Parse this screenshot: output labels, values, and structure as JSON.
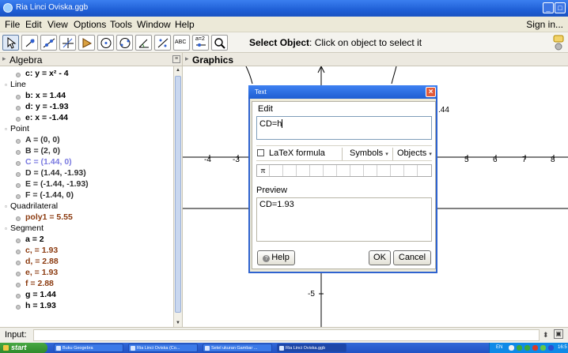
{
  "window": {
    "title": "Ria Linci Oviska.ggb"
  },
  "menu": {
    "items": [
      "File",
      "Edit",
      "View",
      "Options",
      "Tools",
      "Window",
      "Help"
    ],
    "signin": "Sign in..."
  },
  "toolbar": {
    "status_bold": "Select Object",
    "status_rest": ": Click on object to select it",
    "tools": [
      "move-tool",
      "point-tool",
      "line-tool",
      "perpendicular-line-tool",
      "polygon-tool",
      "circle-tool",
      "conic-tool",
      "angle-tool",
      "reflect-tool",
      "text-tool",
      "slider-tool",
      "zoom-tool"
    ],
    "text_tool_label": "ABC",
    "slider_tool_label": "a=2"
  },
  "algebra": {
    "header": "Algebra",
    "groups": [
      {
        "rows": [
          {
            "text": "c: y = x² - 4",
            "color": "#000000"
          }
        ]
      },
      {
        "category": "Line",
        "rows": [
          {
            "text": "b: x = 1.44",
            "color": "#000000"
          },
          {
            "text": "d: y = -1.93",
            "color": "#000000"
          },
          {
            "text": "e: x = -1.44",
            "color": "#000000"
          }
        ]
      },
      {
        "category": "Point",
        "rows": [
          {
            "text": "A = (0, 0)",
            "color": "#303030"
          },
          {
            "text": "B = (2, 0)",
            "color": "#303030"
          },
          {
            "text": "C = (1.44, 0)",
            "color": "#7a7ae0"
          },
          {
            "text": "D = (1.44, -1.93)",
            "color": "#303030"
          },
          {
            "text": "E = (-1.44, -1.93)",
            "color": "#303030"
          },
          {
            "text": "F = (-1.44, 0)",
            "color": "#303030"
          }
        ]
      },
      {
        "category": "Quadrilateral",
        "rows": [
          {
            "text": "poly1 = 5.55",
            "color": "#8b3a0f"
          }
        ]
      },
      {
        "category": "Segment",
        "rows": [
          {
            "text": "a = 2",
            "color": "#000000"
          },
          {
            "text": "c, = 1.93",
            "color": "#8b3a0f"
          },
          {
            "text": "d, = 2.88",
            "color": "#8b3a0f"
          },
          {
            "text": "e, = 1.93",
            "color": "#8b3a0f"
          },
          {
            "text": "f = 2.88",
            "color": "#8b3a0f"
          },
          {
            "text": "g = 1.44",
            "color": "#000000"
          },
          {
            "text": "h = 1.93",
            "color": "#000000"
          }
        ]
      }
    ]
  },
  "graphics": {
    "header": "Graphics",
    "x_ticks": [
      "-4",
      "-3",
      "5",
      "6",
      "7",
      "8"
    ],
    "y_ticks": [
      "-5"
    ],
    "partial_label": ".44"
  },
  "dialog": {
    "title": "Text",
    "edit_label": "Edit",
    "edit_value": "CD=h",
    "latex_label": "LaTeX formula",
    "symbols_label": "Symbols",
    "objects_label": "Objects",
    "symbol_cells": [
      "π",
      "",
      "",
      "",
      "",
      "",
      "",
      "",
      "",
      "",
      "",
      "",
      ""
    ],
    "preview_label": "Preview",
    "preview_value": "CD=1.93",
    "help_label": "Help",
    "ok_label": "OK",
    "cancel_label": "Cancel"
  },
  "inputbar": {
    "label": "Input:"
  },
  "taskbar": {
    "start_label": "start",
    "tasks": [
      "Buku Geogebra",
      "Ria Linci Oviska (Co...",
      "Setel ukuran Gambar ...",
      "Ria Linci Oviska.ggb"
    ],
    "lang": "EN",
    "clock": "16:5"
  }
}
